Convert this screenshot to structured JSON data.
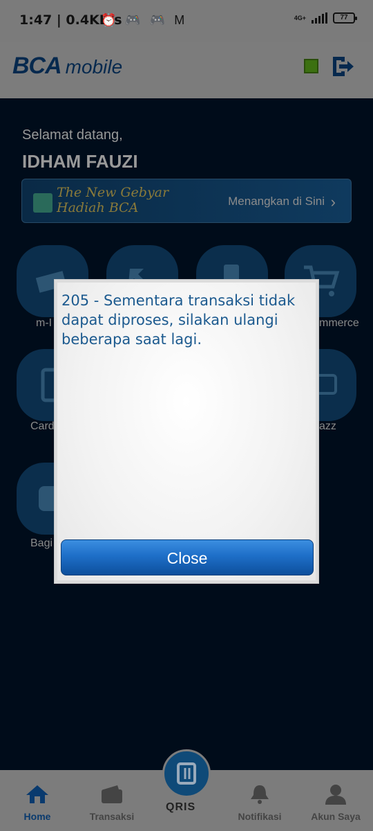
{
  "status_bar": {
    "time": "1:47 | 0.4KB/s",
    "network": "4G+",
    "battery": "77"
  },
  "header": {
    "logo_primary": "BCA",
    "logo_secondary": "mobile"
  },
  "greeting": {
    "welcome": "Selamat datang,",
    "user_name": "IDHAM FAUZI"
  },
  "banner": {
    "promo_line1": "The New Gebyar",
    "promo_line2": "Hadiah BCA",
    "cta": "Menangkan di Sini"
  },
  "menu": {
    "row1": [
      {
        "label": "m-I"
      },
      {
        "label": ""
      },
      {
        "label": ""
      },
      {
        "label": "mmerce"
      }
    ],
    "row2": [
      {
        "label": "Card"
      },
      {
        "label": "azz"
      }
    ],
    "row3": [
      {
        "label": "Bagi"
      }
    ]
  },
  "dialog": {
    "message": "205 - Sementara transaksi tidak dapat diproses, silakan ulangi beberapa saat lagi.",
    "close_label": "Close"
  },
  "bottom_nav": {
    "items": [
      {
        "label": "Home",
        "active": true
      },
      {
        "label": "Transaksi"
      },
      {
        "label": "QRIS"
      },
      {
        "label": "Notifikasi"
      },
      {
        "label": "Akun Saya"
      }
    ]
  },
  "colors": {
    "brand_blue": "#093a6e",
    "dialog_text": "#1c5a8f",
    "button_blue": "#1e6fc8",
    "status_green": "#3c7011"
  }
}
